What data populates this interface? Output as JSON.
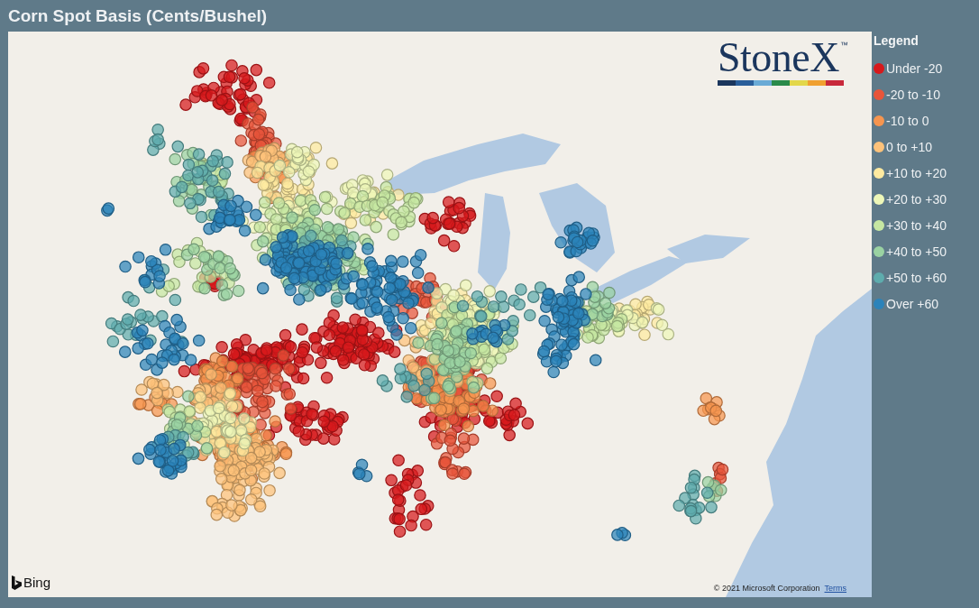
{
  "title": "Corn Spot Basis (Cents/Bushel)",
  "map": {
    "logo": {
      "text": "StoneX",
      "mark": "™"
    },
    "provider": {
      "name": "Bing"
    },
    "copyright": "© 2021 Microsoft Corporation",
    "terms_link": "Terms"
  },
  "legend": {
    "title": "Legend",
    "items": [
      {
        "label": "Under -20",
        "color": "#d7191c"
      },
      {
        "label": "-20 to -10",
        "color": "#e8553a"
      },
      {
        "label": "-10 to 0",
        "color": "#f6954f"
      },
      {
        "label": "0 to +10",
        "color": "#fdc27a"
      },
      {
        "label": "+10 to +20",
        "color": "#feeaa0"
      },
      {
        "label": "+20 to +30",
        "color": "#eef7b8"
      },
      {
        "label": "+30 to +40",
        "color": "#c6e7a2"
      },
      {
        "label": "+40 to +50",
        "color": "#9ad2a2"
      },
      {
        "label": "+50 to +60",
        "color": "#5eacad"
      },
      {
        "label": "Over +60",
        "color": "#2b83ba"
      }
    ]
  }
}
